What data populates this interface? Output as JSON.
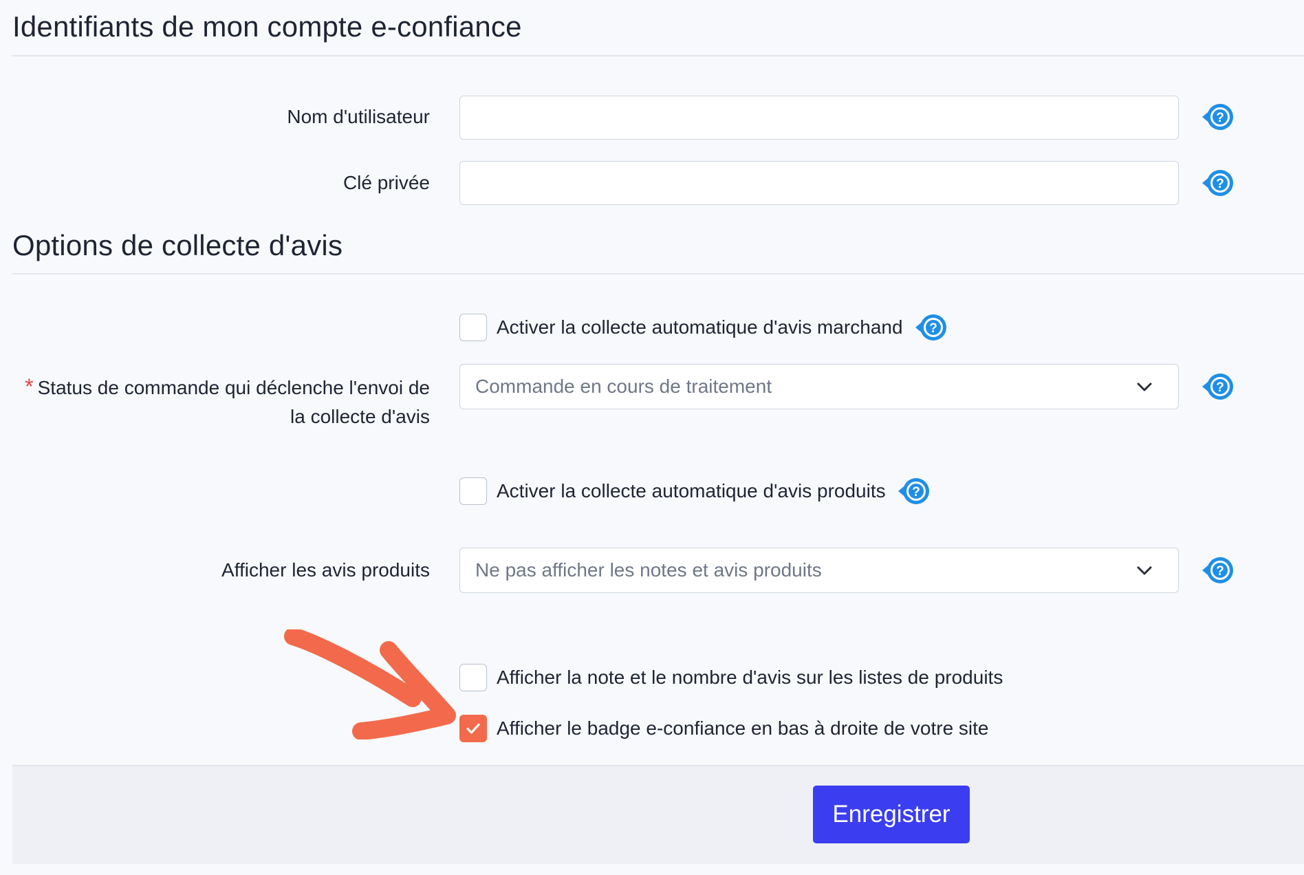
{
  "credentials_section": {
    "title": "Identifiants de mon compte e-confiance",
    "username_label": "Nom d'utilisateur",
    "username_value": "",
    "private_key_label": "Clé privée",
    "private_key_value": ""
  },
  "options_section": {
    "title": "Options de collecte d'avis",
    "merchant_review_checkbox": {
      "label": "Activer la collecte automatique d'avis marchand",
      "checked": false
    },
    "order_status": {
      "required_marker": "*",
      "label_line1": "Status de commande qui déclenche l'envoi de",
      "label_line2": "la collecte d'avis",
      "selected": "Commande en cours de traitement"
    },
    "product_review_checkbox": {
      "label": "Activer la collecte automatique d'avis produits",
      "checked": false
    },
    "display_product_reviews": {
      "label": "Afficher les avis produits",
      "selected": "Ne pas afficher les notes et avis produits"
    },
    "rating_on_lists_checkbox": {
      "label": "Afficher la note et le nombre d'avis sur les listes de produits",
      "checked": false
    },
    "badge_checkbox": {
      "label": "Afficher le badge e-confiance en bas à droite de votre site",
      "checked": true
    }
  },
  "footer": {
    "save_label": "Enregistrer"
  },
  "icons": {
    "help": "question-mark-help-icon",
    "dropdown": "chevron-down-icon",
    "check": "checkmark-icon",
    "annotation": "orange-arrow-annotation"
  },
  "colors": {
    "help_icon": "#1f8fe5",
    "checked_box": "#f26a4b",
    "save_button": "#3b3df0",
    "required": "#e3473c",
    "arrow": "#f26a4b"
  }
}
